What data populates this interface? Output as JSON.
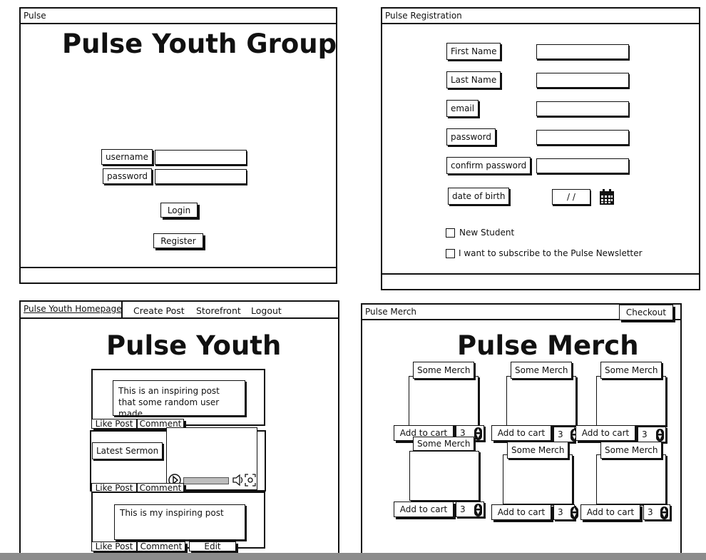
{
  "login": {
    "window_title": "Pulse",
    "heading": "Pulse Youth Group",
    "username_label": "username",
    "password_label": "password",
    "login_button": "Login",
    "register_button": "Register"
  },
  "registration": {
    "window_title": "Pulse Registration",
    "first_name_label": "First Name",
    "last_name_label": "Last Name",
    "email_label": "email",
    "password_label": "password",
    "confirm_password_label": "confirm password",
    "dob_label": "date of birth",
    "dob_value": "/ /",
    "new_student_label": "New Student",
    "newsletter_label": "I want to subscribe to the Pulse Newsletter"
  },
  "homepage": {
    "tab_home": "Pulse Youth Homepage",
    "nav_create_post": "Create Post",
    "nav_storefront": "Storefront",
    "nav_logout": "Logout",
    "heading": "Pulse Youth",
    "post1_text": "This is an inspiring post that some random user made",
    "like_label": "Like Post",
    "comment_label": "Comment",
    "sermon_label": "Latest Sermon",
    "post3_text": "This is my inspiring post",
    "edit_label": "Edit"
  },
  "merch": {
    "window_title": "Pulse Merch",
    "checkout_button": "Checkout",
    "heading": "Pulse Merch",
    "item_title": "Some Merch",
    "add_to_cart": "Add to cart",
    "quantity": "3"
  },
  "colors": {
    "ink": "#111111",
    "paper": "#ffffff",
    "footer_bar": "#8c8c8c"
  }
}
